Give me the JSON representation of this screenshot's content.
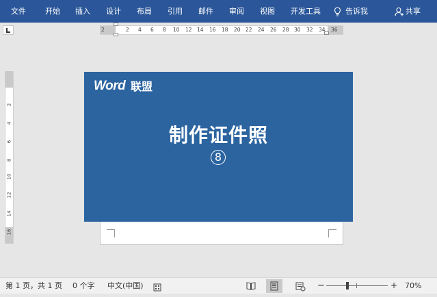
{
  "ribbon": {
    "tabs": [
      "文件",
      "开始",
      "插入",
      "设计",
      "布局",
      "引用",
      "邮件",
      "审阅",
      "视图",
      "开发工具"
    ],
    "tell_me": "告诉我",
    "share": "共享"
  },
  "ruler": {
    "h_numbers": [
      "2",
      "2",
      "4",
      "6",
      "8",
      "10",
      "12",
      "14",
      "16",
      "18",
      "20",
      "22",
      "24",
      "26",
      "28",
      "30",
      "32",
      "34",
      "36"
    ],
    "v_numbers": [
      "2",
      "4",
      "6",
      "8",
      "10",
      "12",
      "14",
      "16"
    ]
  },
  "cover": {
    "logo_word": "Word",
    "logo_cn": "联盟",
    "title": "制作证件照",
    "number": "8"
  },
  "status": {
    "page_info": "第 1 页，共 1 页",
    "word_count": "0 个字",
    "language": "中文(中国)",
    "zoom_minus": "−",
    "zoom_plus": "+",
    "zoom_level": "70%",
    "zoom_percent": 70
  },
  "colors": {
    "ribbon": "#2b579a",
    "cover": "#2c64a0"
  }
}
